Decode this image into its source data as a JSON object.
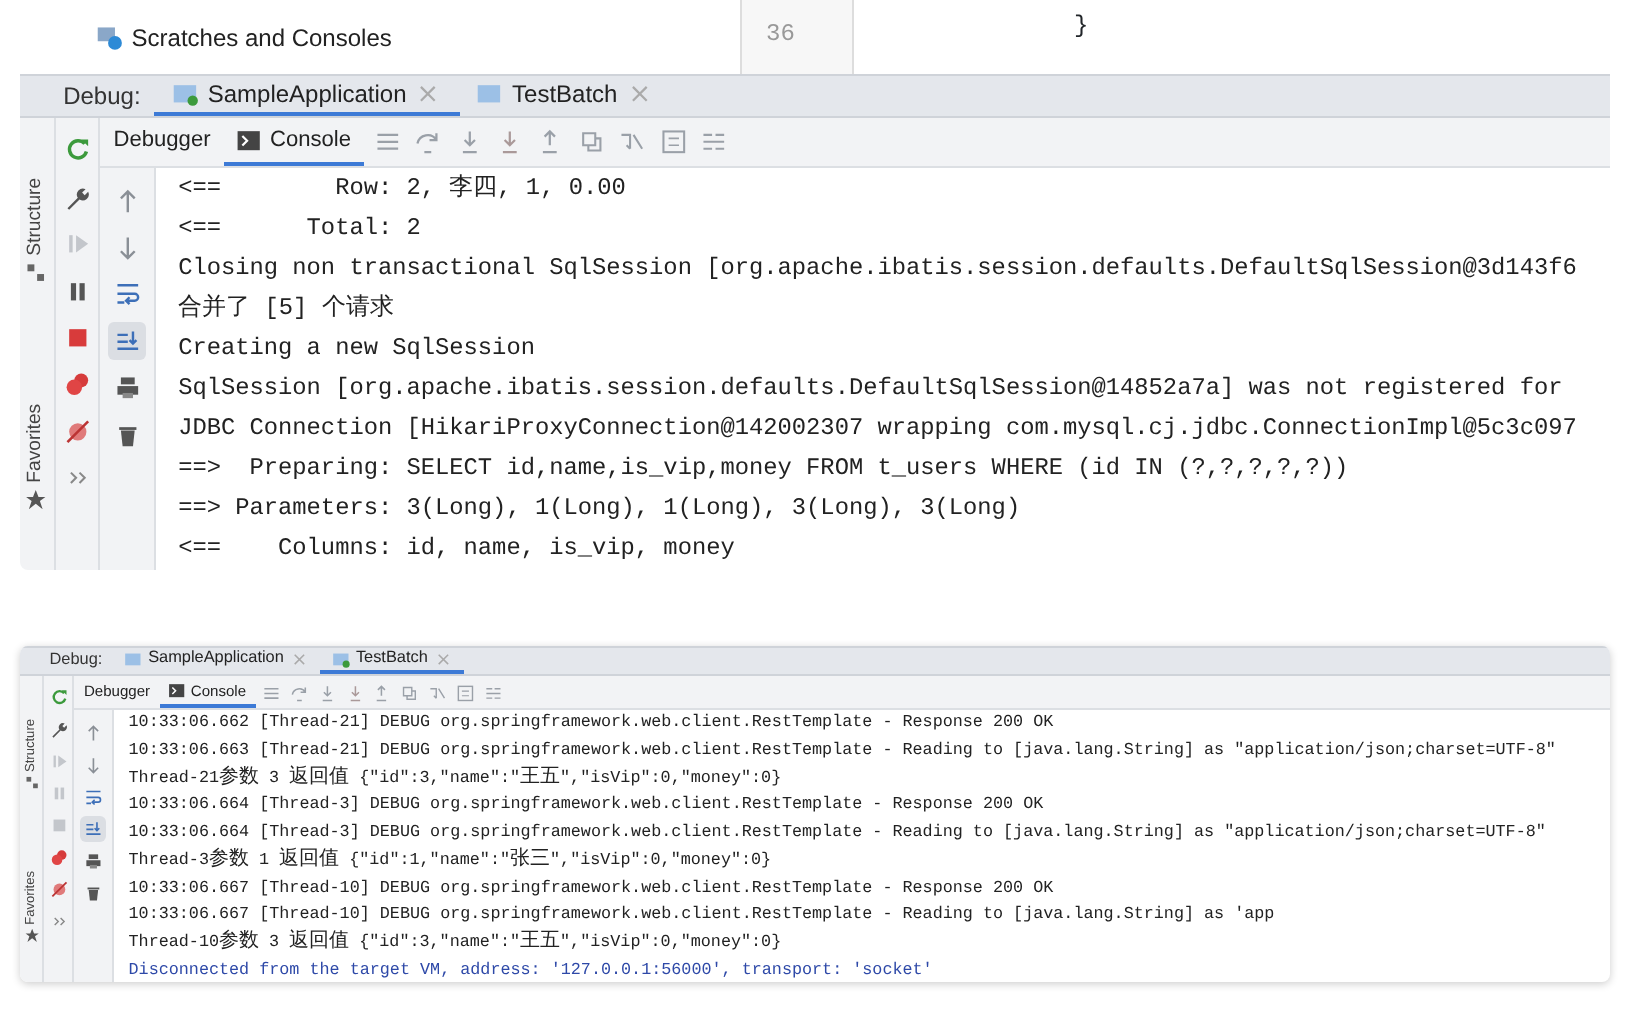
{
  "panels": [
    {
      "project_tree": [
        {
          "label": "Scratches and Consoles"
        }
      ],
      "editor": {
        "line_number": "36",
        "code": "}"
      },
      "debug_label": "Debug:",
      "run_tabs": [
        {
          "label": "SampleApplication",
          "selected": true
        },
        {
          "label": "TestBatch",
          "selected": false
        }
      ],
      "view_tabs": [
        {
          "label": "Debugger",
          "selected": false
        },
        {
          "label": "Console",
          "selected": true
        }
      ],
      "side_strip": [
        {
          "label": "Structure"
        },
        {
          "label": "Favorites"
        }
      ],
      "debug_tools": [
        {
          "kind": "rerun",
          "disabled": false
        },
        {
          "kind": "settings",
          "disabled": false
        },
        {
          "kind": "resume",
          "disabled": true
        },
        {
          "kind": "pause",
          "disabled": false
        },
        {
          "kind": "stop",
          "disabled": false
        },
        {
          "kind": "breakpoints",
          "disabled": false
        },
        {
          "kind": "mute",
          "disabled": false
        },
        {
          "kind": "more",
          "disabled": false
        }
      ],
      "console_tools": [
        {
          "kind": "up",
          "selected": false
        },
        {
          "kind": "down",
          "selected": false
        },
        {
          "kind": "wrap",
          "selected": false
        },
        {
          "kind": "scroll-end",
          "selected": true
        },
        {
          "kind": "print",
          "selected": false
        },
        {
          "kind": "trash",
          "selected": false
        }
      ],
      "lines": [
        {
          "text": "<==        Row: 2, 李四, 1, 0.00",
          "kind": "normal"
        },
        {
          "text": "<==      Total: 2",
          "kind": "normal"
        },
        {
          "text": "Closing non transactional SqlSession [org.apache.ibatis.session.defaults.DefaultSqlSession@3d143f6",
          "kind": "normal"
        },
        {
          "text": "合并了 [5] 个请求",
          "kind": "normal"
        },
        {
          "text": "Creating a new SqlSession",
          "kind": "normal"
        },
        {
          "text": "SqlSession [org.apache.ibatis.session.defaults.DefaultSqlSession@14852a7a] was not registered for",
          "kind": "normal"
        },
        {
          "text": "JDBC Connection [HikariProxyConnection@142002307 wrapping com.mysql.cj.jdbc.ConnectionImpl@5c3c097",
          "kind": "normal"
        },
        {
          "text": "==>  Preparing: SELECT id,name,is_vip,money FROM t_users WHERE (id IN (?,?,?,?,?))",
          "kind": "normal"
        },
        {
          "text": "==> Parameters: 3(Long), 1(Long), 1(Long), 3(Long), 3(Long)",
          "kind": "normal"
        },
        {
          "text": "<==    Columns: id, name, is_vip, money",
          "kind": "normal"
        }
      ]
    },
    {
      "debug_label": "Debug:",
      "run_tabs": [
        {
          "label": "SampleApplication",
          "selected": false
        },
        {
          "label": "TestBatch",
          "selected": true
        }
      ],
      "view_tabs": [
        {
          "label": "Debugger",
          "selected": false
        },
        {
          "label": "Console",
          "selected": true
        }
      ],
      "side_strip": [
        {
          "label": "Structure"
        },
        {
          "label": "Favorites"
        }
      ],
      "debug_tools": [
        {
          "kind": "rerun",
          "disabled": false
        },
        {
          "kind": "settings",
          "disabled": false
        },
        {
          "kind": "resume",
          "disabled": true
        },
        {
          "kind": "pause",
          "disabled": true
        },
        {
          "kind": "stop",
          "disabled": true
        },
        {
          "kind": "breakpoints",
          "disabled": false
        },
        {
          "kind": "mute",
          "disabled": false
        },
        {
          "kind": "more",
          "disabled": false
        }
      ],
      "console_tools": [
        {
          "kind": "up",
          "selected": false
        },
        {
          "kind": "down",
          "selected": false
        },
        {
          "kind": "wrap",
          "selected": false
        },
        {
          "kind": "scroll-end",
          "selected": true
        },
        {
          "kind": "print",
          "selected": false
        },
        {
          "kind": "trash",
          "selected": false
        }
      ],
      "lines": [
        {
          "text": "10:33:06.662 [Thread-21] DEBUG org.springframework.web.client.RestTemplate - Response 200 OK",
          "kind": "normal"
        },
        {
          "text": "10:33:06.663 [Thread-21] DEBUG org.springframework.web.client.RestTemplate - Reading to [java.lang.String] as \"application/json;charset=UTF-8\"",
          "kind": "normal"
        },
        {
          "text": "Thread-21参数 3 返回值 {\"id\":3,\"name\":\"王五\",\"isVip\":0,\"money\":0}",
          "kind": "normal"
        },
        {
          "text": "10:33:06.664 [Thread-3] DEBUG org.springframework.web.client.RestTemplate - Response 200 OK",
          "kind": "normal"
        },
        {
          "text": "10:33:06.664 [Thread-3] DEBUG org.springframework.web.client.RestTemplate - Reading to [java.lang.String] as \"application/json;charset=UTF-8\"",
          "kind": "normal"
        },
        {
          "text": "Thread-3参数 1 返回值 {\"id\":1,\"name\":\"张三\",\"isVip\":0,\"money\":0}",
          "kind": "normal"
        },
        {
          "text": "10:33:06.667 [Thread-10] DEBUG org.springframework.web.client.RestTemplate - Response 200 OK",
          "kind": "normal"
        },
        {
          "text": "10:33:06.667 [Thread-10] DEBUG org.springframework.web.client.RestTemplate - Reading to [java.lang.String] as 'app",
          "kind": "normal"
        },
        {
          "text": "Thread-10参数 3 返回值 {\"id\":3,\"name\":\"王五\",\"isVip\":0,\"money\":0}",
          "kind": "normal"
        },
        {
          "text": "Disconnected from the target VM, address: '127.0.0.1:56000', transport: 'socket'",
          "kind": "info"
        }
      ]
    }
  ]
}
